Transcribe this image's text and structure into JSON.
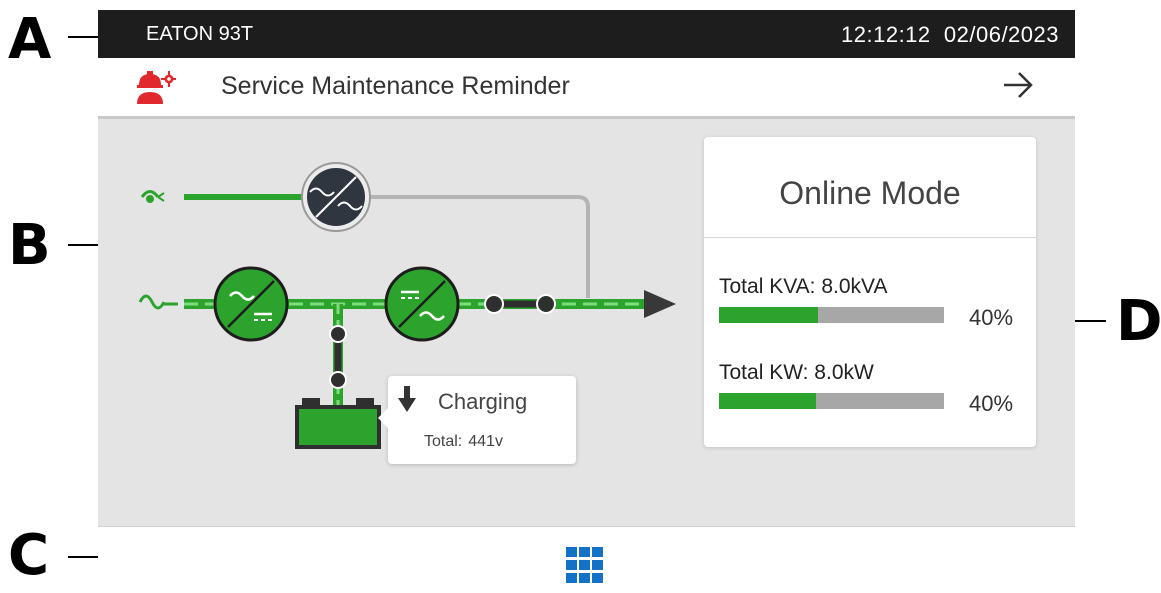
{
  "callouts": {
    "a": "A",
    "b": "B",
    "c": "C",
    "d": "D"
  },
  "header": {
    "model": "EATON 93T",
    "time": "12:12:12",
    "date": "02/06/2023"
  },
  "notification": {
    "icon": "service-technician-icon",
    "text": "Service Maintenance Reminder",
    "action_icon": "arrow-right-icon"
  },
  "battery_popup": {
    "status": "Charging",
    "total_label": "Total:",
    "total_value": "441v"
  },
  "status_card": {
    "mode": "Online Mode",
    "metrics": [
      {
        "label": "Total KVA: 8.0kVA",
        "percent_text": "40%",
        "fill_fraction": 0.44
      },
      {
        "label": "Total KW: 8.0kW",
        "percent_text": "40%",
        "fill_fraction": 0.43
      }
    ]
  },
  "footer": {
    "menu_icon": "app-grid-icon"
  },
  "colors": {
    "accent_green": "#2ca32c",
    "light_green": "#5fcb5f",
    "dark_bar": "#1d1d1d",
    "alert_red": "#e0282d",
    "menu_blue": "#1371c6"
  }
}
